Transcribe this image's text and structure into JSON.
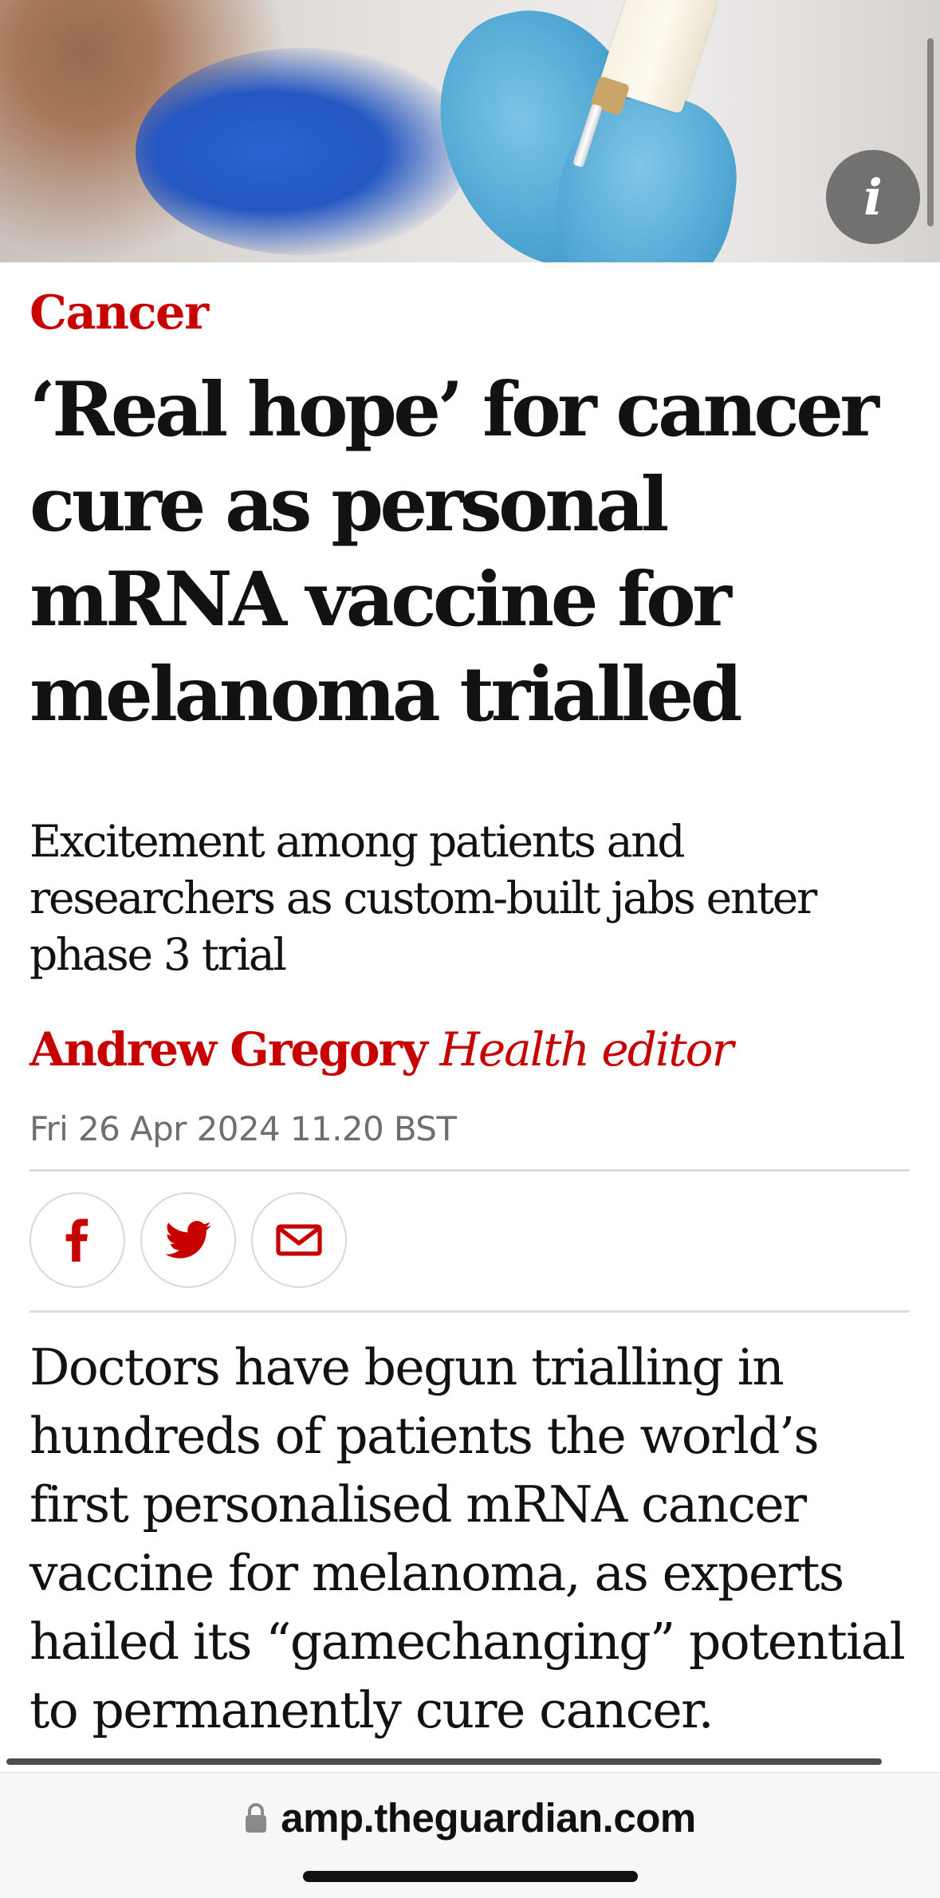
{
  "hero": {
    "info_label": "i"
  },
  "article": {
    "kicker": "Cancer",
    "headline": "‘Real hope’ for cancer cure as personal mRNA vaccine for melanoma trialled",
    "standfirst": "Excitement among patients and researchers as custom-built jabs enter phase 3 trial",
    "byline": {
      "author": "Andrew Gregory",
      "role": "Health editor"
    },
    "date": "Fri 26 Apr 2024 11.20 BST",
    "share": [
      {
        "icon": "facebook-icon"
      },
      {
        "icon": "twitter-icon"
      },
      {
        "icon": "email-icon"
      }
    ],
    "body": "Doctors have begun trialling in hundreds of patients the world’s first personalised mRNA cancer vaccine for melanoma, as experts hailed its “gamechanging” potential to permanently cure cancer."
  },
  "colors": {
    "accent": "#c70000",
    "text": "#121212",
    "muted": "#6f6f6f"
  },
  "browser": {
    "url": "amp.theguardian.com",
    "lock_icon": "lock-icon"
  }
}
